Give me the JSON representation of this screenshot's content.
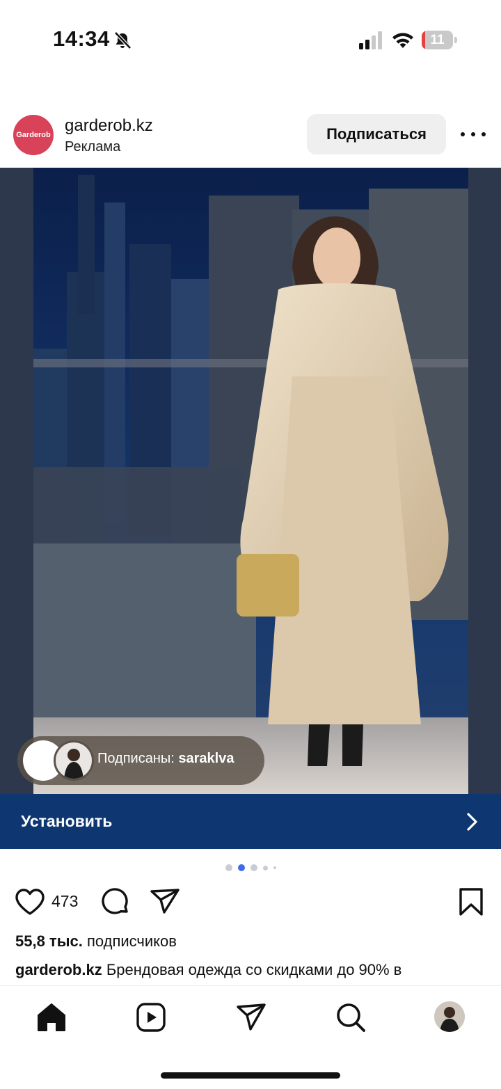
{
  "status_bar": {
    "time": "14:34",
    "battery_level": "11",
    "battery_fraction": 0.11,
    "icons": [
      "bell-slash-icon",
      "cellular-signal-icon",
      "wifi-icon",
      "battery-icon"
    ]
  },
  "post": {
    "account": "garderob.kz",
    "avatar_text": "Garderob",
    "sponsored": "Реклама",
    "follow_label": "Подписаться",
    "more_icon": "ellipsis-icon",
    "followed_by_prefix": "Подписаны:",
    "followed_by_user": "saraklva",
    "install_label": "Установить",
    "carousel": {
      "count": 5,
      "active": 2
    },
    "likes": "473",
    "followers_count": "55,8 тыс.",
    "followers_label": "подписчиков",
    "caption_user": "garderob.kz",
    "caption_text": "Брендовая одежда со скидками до 90% в"
  },
  "nav": {
    "items": [
      "home-icon",
      "reels-icon",
      "direct-icon",
      "search-icon",
      "profile-avatar"
    ]
  },
  "colors": {
    "brand_avatar": "#d8435a",
    "install_bar": "#0e3670",
    "active_dot": "#3f6ae8"
  }
}
